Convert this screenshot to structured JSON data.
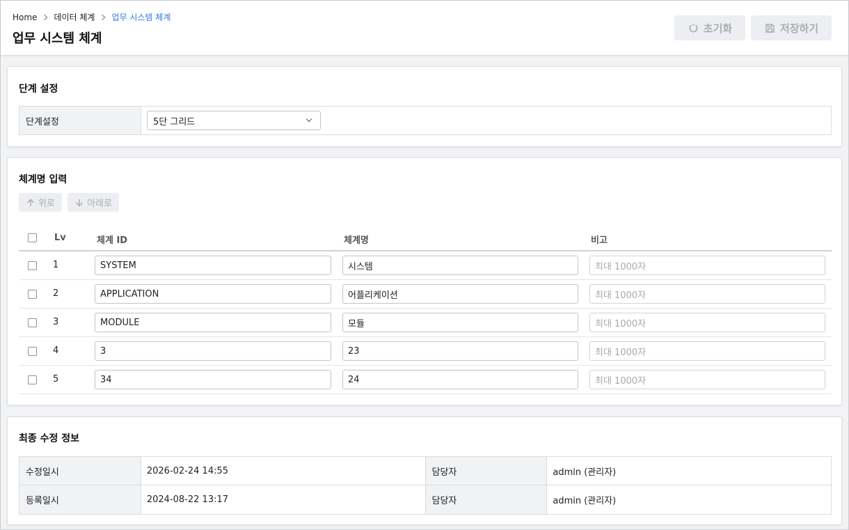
{
  "breadcrumb": [
    "Home",
    "데이터 체계",
    "업무 시스템 체계"
  ],
  "page_title": "업무 시스템 체계",
  "toolbar": {
    "reset_label": "초기화",
    "save_label": "저장하기"
  },
  "level_section": {
    "title": "단계 설정",
    "field_label": "단계설정",
    "selected_option": "5단 그리드"
  },
  "name_section": {
    "title": "체계명 입력",
    "up_label": "위로",
    "down_label": "아래로",
    "columns": {
      "lv": "Lv",
      "id": "체계 ID",
      "name": "체계명",
      "note": "비고"
    },
    "note_placeholder": "최대 1000자",
    "rows": [
      {
        "lv": "1",
        "id": "SYSTEM",
        "name": "시스템",
        "note": ""
      },
      {
        "lv": "2",
        "id": "APPLICATION",
        "name": "어플리케이션",
        "note": ""
      },
      {
        "lv": "3",
        "id": "MODULE",
        "name": "모듈",
        "note": ""
      },
      {
        "lv": "4",
        "id": "3",
        "name": "23",
        "note": ""
      },
      {
        "lv": "5",
        "id": "34",
        "name": "24",
        "note": ""
      }
    ]
  },
  "info_section": {
    "title": "최종 수정 정보",
    "rows": [
      {
        "label": "수정일시",
        "value": "2026-02-24 14:55",
        "owner_label": "담당자",
        "owner": "admin (관리자)"
      },
      {
        "label": "등록일시",
        "value": "2024-08-22 13:17",
        "owner_label": "담당자",
        "owner": "admin (관리자)"
      }
    ]
  },
  "colors": {
    "accent": "#2f7be0",
    "disabled_bg": "#eceef1",
    "disabled_text": "#a9adb3"
  }
}
